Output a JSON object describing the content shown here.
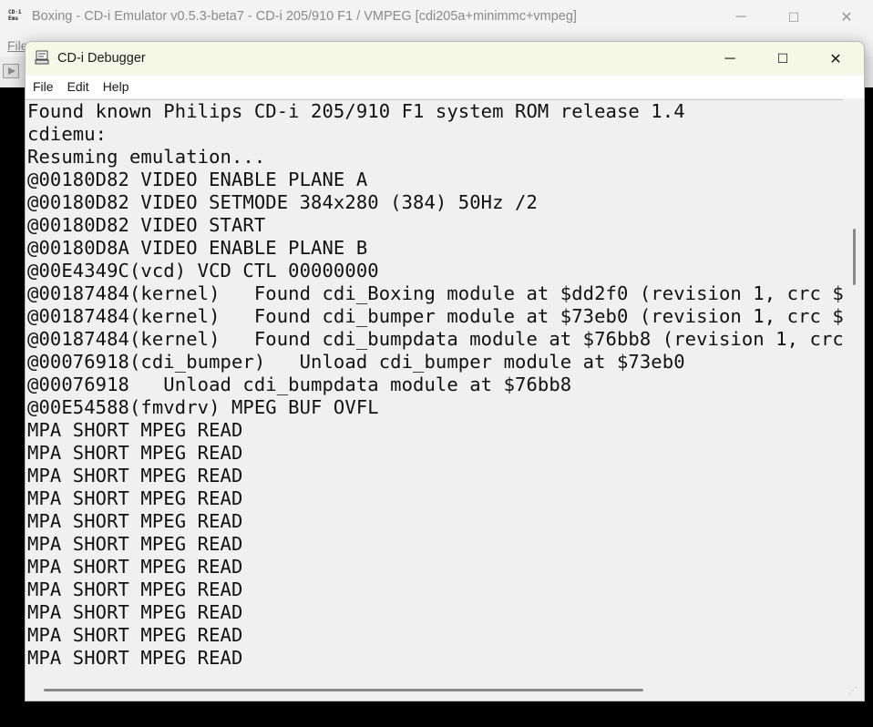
{
  "background_window": {
    "title": "Boxing - CD-i Emulator v0.5.3-beta7 - CD-i 205/910 F1 / VMPEG [cdi205a+minimmc+vmpeg]",
    "menu_file": "File",
    "minimize": "─",
    "maximize": "☐",
    "close": "✕"
  },
  "debugger": {
    "title": "CD-i Debugger",
    "minimize": "─",
    "maximize": "☐",
    "close": "✕",
    "menu": [
      "File",
      "Edit",
      "Help"
    ],
    "log_lines": [
      "Found known Philips CD-i 205/910 F1 system ROM release 1.4",
      "cdiemu:",
      "Resuming emulation...",
      "@00180D82 VIDEO ENABLE PLANE A",
      "@00180D82 VIDEO SETMODE 384x280 (384) 50Hz /2",
      "@00180D82 VIDEO START",
      "@00180D8A VIDEO ENABLE PLANE B",
      "@00E4349C(vcd) VCD CTL 00000000",
      "@00187484(kernel)   Found cdi_Boxing module at $dd2f0 (revision 1, crc $",
      "@00187484(kernel)   Found cdi_bumper module at $73eb0 (revision 1, crc $",
      "@00187484(kernel)   Found cdi_bumpdata module at $76bb8 (revision 1, crc",
      "@00076918(cdi_bumper)   Unload cdi_bumper module at $73eb0",
      "@00076918   Unload cdi_bumpdata module at $76bb8",
      "@00E54588(fmvdrv) MPEG BUF OVFL",
      "MPA SHORT MPEG READ",
      "MPA SHORT MPEG READ",
      "MPA SHORT MPEG READ",
      "MPA SHORT MPEG READ",
      "MPA SHORT MPEG READ",
      "MPA SHORT MPEG READ",
      "MPA SHORT MPEG READ",
      "MPA SHORT MPEG READ",
      "MPA SHORT MPEG READ",
      "MPA SHORT MPEG READ",
      "MPA SHORT MPEG READ"
    ]
  }
}
